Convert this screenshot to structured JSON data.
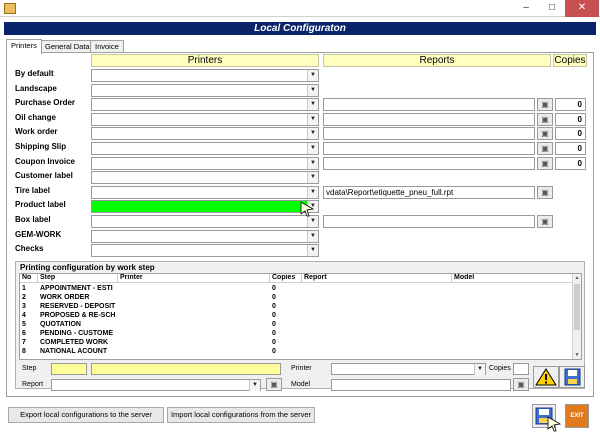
{
  "window": {
    "title": "",
    "minimize": "–",
    "maximize": "□",
    "close": "✕"
  },
  "banner": "Local Configuraton",
  "tabs": [
    "Printers",
    "General Data",
    "Invoice"
  ],
  "headers": {
    "printers": "Printers",
    "reports": "Reports",
    "copies": "Copies"
  },
  "rows": [
    {
      "label": "By default",
      "report": null,
      "copies": null,
      "highlight": false
    },
    {
      "label": "Landscape",
      "report": null,
      "copies": null,
      "highlight": false
    },
    {
      "label": "Purchase Order",
      "report": "",
      "copies": "0",
      "highlight": false
    },
    {
      "label": "Oil change",
      "report": "",
      "copies": "0",
      "highlight": false
    },
    {
      "label": "Work order",
      "report": "",
      "copies": "0",
      "highlight": false
    },
    {
      "label": "Shipping Slip",
      "report": "",
      "copies": "0",
      "highlight": false
    },
    {
      "label": "Coupon Invoice",
      "report": "",
      "copies": "0",
      "highlight": false
    },
    {
      "label": "Customer label",
      "report": null,
      "copies": null,
      "highlight": false
    },
    {
      "label": "Tire label",
      "report": "vdata\\Report\\etiquette_pneu_full.rpt",
      "copies": null,
      "highlight": false
    },
    {
      "label": "Product label",
      "report": null,
      "copies": null,
      "highlight": true
    },
    {
      "label": "Box label",
      "report": "",
      "copies": null,
      "highlight": false
    },
    {
      "label": "GEM-WORK",
      "report": null,
      "copies": null,
      "highlight": false
    },
    {
      "label": "Checks",
      "report": null,
      "copies": null,
      "highlight": false
    }
  ],
  "workstep": {
    "title": "Printing configuration by work step",
    "columns": [
      "No",
      "Step",
      "Printer",
      "Copies",
      "Report",
      "Model"
    ],
    "items": [
      {
        "no": "1",
        "step": "APPOINTMENT - ESTI",
        "copies": "0"
      },
      {
        "no": "2",
        "step": "WORK ORDER",
        "copies": "0"
      },
      {
        "no": "3",
        "step": "RESERVED - DEPOSIT",
        "copies": "0"
      },
      {
        "no": "4",
        "step": "PROPOSED & RE-SCH",
        "copies": "0"
      },
      {
        "no": "5",
        "step": "QUOTATION",
        "copies": "0"
      },
      {
        "no": "6",
        "step": "PENDING - CUSTOME",
        "copies": "0"
      },
      {
        "no": "7",
        "step": "COMPLETED WORK",
        "copies": "0"
      },
      {
        "no": "8",
        "step": "NATIONAL ACOUNT",
        "copies": "0"
      }
    ],
    "fields": {
      "step": "Step",
      "report": "Report",
      "printer": "Printer",
      "model": "Model",
      "copies": "Copies"
    }
  },
  "buttons": {
    "export": "Export local configurations to the server",
    "import": "Import local configurations from the server",
    "exit": "EXIT"
  },
  "colors": {
    "banner": "#0a246a",
    "header": "#ffffc0",
    "highlight": "#00ff00",
    "field": "#ffff99"
  }
}
